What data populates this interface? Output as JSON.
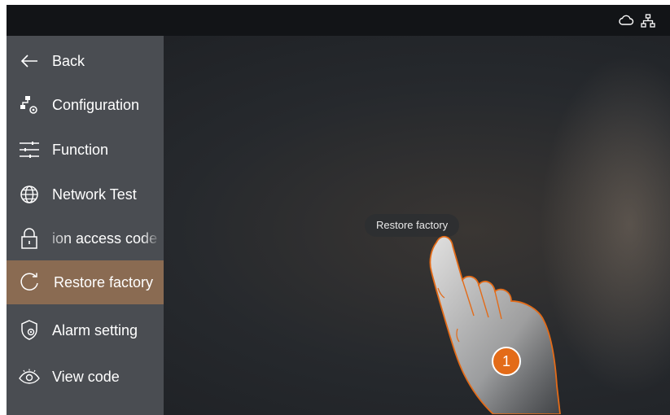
{
  "status_bar": {
    "icons": [
      "cloud-icon",
      "network-icon"
    ]
  },
  "sidebar": {
    "items": [
      {
        "label": "Back",
        "icon": "back-arrow-icon"
      },
      {
        "label": "Configuration",
        "icon": "configuration-icon"
      },
      {
        "label": "Function",
        "icon": "sliders-icon"
      },
      {
        "label": "Network Test",
        "icon": "globe-icon"
      },
      {
        "label": "ion access code",
        "icon": "lock-icon"
      },
      {
        "label": "Restore factory",
        "icon": "restore-icon",
        "selected": true
      },
      {
        "label": "Alarm setting",
        "icon": "shield-gear-icon"
      },
      {
        "label": "View code",
        "icon": "eye-icon"
      }
    ]
  },
  "tooltip": {
    "label": "Restore factory"
  },
  "step_badge": {
    "number": "1"
  },
  "colors": {
    "accent": "#e36b18",
    "selected_bg": "#8a6b52",
    "sidebar_bg": "#4a4d52"
  }
}
